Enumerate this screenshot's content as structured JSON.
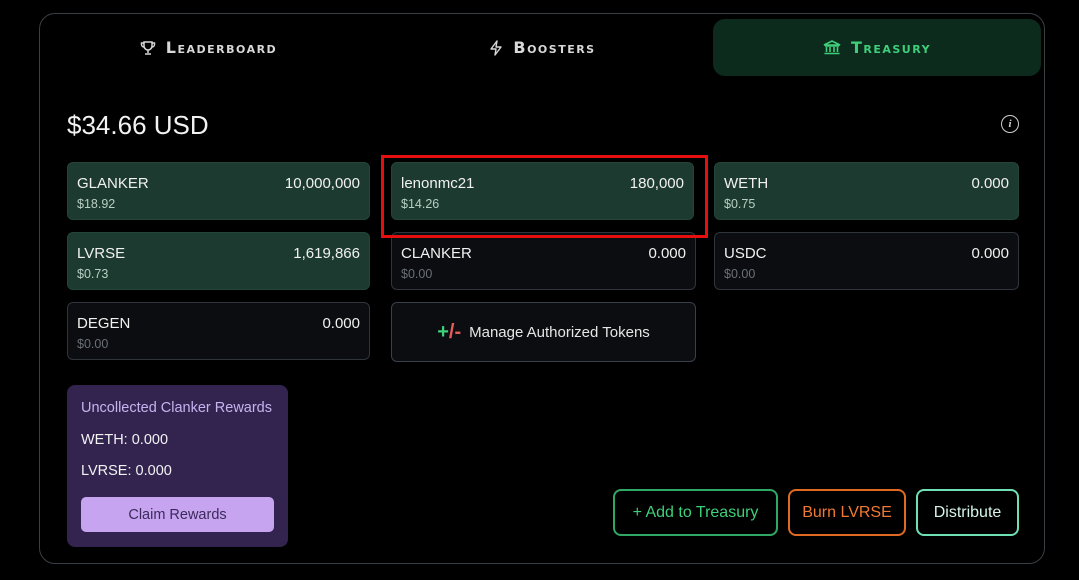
{
  "tabs": [
    {
      "label": "Leaderboard",
      "icon": "trophy-icon",
      "active": false
    },
    {
      "label": "Boosters",
      "icon": "lightning-icon",
      "active": false
    },
    {
      "label": "Treasury",
      "icon": "bank-icon",
      "active": true
    }
  ],
  "treasury": {
    "total_usd": "$34.66 USD",
    "info_icon": "info-icon",
    "tokens": [
      {
        "symbol": "GLANKER",
        "amount": "10,000,000",
        "usd": "$18.92",
        "style": "green"
      },
      {
        "symbol": "lenonmc21",
        "amount": "180,000",
        "usd": "$14.26",
        "style": "green"
      },
      {
        "symbol": "WETH",
        "amount": "0.000",
        "usd": "$0.75",
        "style": "green"
      },
      {
        "symbol": "LVRSE",
        "amount": "1,619,866",
        "usd": "$0.73",
        "style": "green"
      },
      {
        "symbol": "CLANKER",
        "amount": "0.000",
        "usd": "$0.00",
        "style": "dark"
      },
      {
        "symbol": "USDC",
        "amount": "0.000",
        "usd": "$0.00",
        "style": "dark"
      },
      {
        "symbol": "DEGEN",
        "amount": "0.000",
        "usd": "$0.00",
        "style": "dark"
      }
    ],
    "manage_button": {
      "prefix_plus": "+",
      "prefix_minus": "/-",
      "label": "Manage Authorized Tokens"
    }
  },
  "rewards": {
    "title": "Uncollected Clanker Rewards",
    "weth": "WETH: 0.000",
    "lvrse": "LVRSE: 0.000",
    "claim_label": "Claim Rewards"
  },
  "actions": {
    "add_label": "+ Add to Treasury",
    "burn_label": "Burn LVRSE",
    "distribute_label": "Distribute"
  },
  "colors": {
    "accent_green": "#3ecf7a",
    "card_green": "#1c3a2f",
    "burn_orange": "#f07a33",
    "rewards_purple": "#33244f",
    "claim_purple": "#c7a4f0",
    "highlight_red": "#e60f0f"
  }
}
